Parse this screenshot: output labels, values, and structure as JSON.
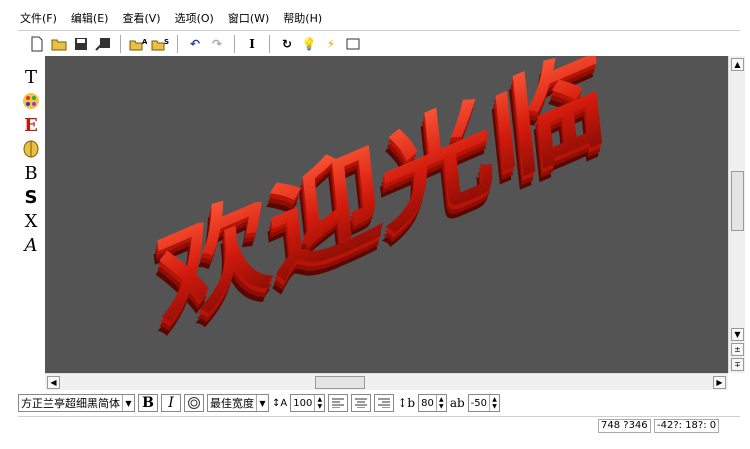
{
  "menu": [
    "文件(F)",
    "编辑(E)",
    "查看(V)",
    "选项(O)",
    "窗口(W)",
    "帮助(H)"
  ],
  "toolbar_icons": [
    "new-icon",
    "open-icon",
    "save-icon",
    "save-as-icon",
    "open-a-icon",
    "open-s-icon",
    "undo-icon",
    "redo-icon",
    "text-cursor-icon",
    "rotate-icon",
    "light-icon",
    "lightning-icon",
    "frame-icon"
  ],
  "left_tools": [
    {
      "name": "text-tool",
      "glyph": "T"
    },
    {
      "name": "palette-tool",
      "glyph": "🎨"
    },
    {
      "name": "edit-tool",
      "glyph": "E"
    },
    {
      "name": "material-tool",
      "glyph": "◍"
    },
    {
      "name": "bevel-tool",
      "glyph": "B"
    },
    {
      "name": "shadow-tool",
      "glyph": "S"
    },
    {
      "name": "x-tool",
      "glyph": "X"
    },
    {
      "name": "outline-tool",
      "glyph": "A"
    }
  ],
  "canvas": {
    "text": "欢迎光临",
    "background": "#545454",
    "text_color": "#d21a0c"
  },
  "format": {
    "font": "方正兰亭超细黑简体",
    "bold": "B",
    "italic": "I",
    "width_mode": "最佳宽度",
    "size": "100",
    "line_spacing": "80",
    "char_spacing": "-50"
  },
  "status": {
    "position": "748 ?346",
    "angle": "-42?: 18?: 0"
  }
}
